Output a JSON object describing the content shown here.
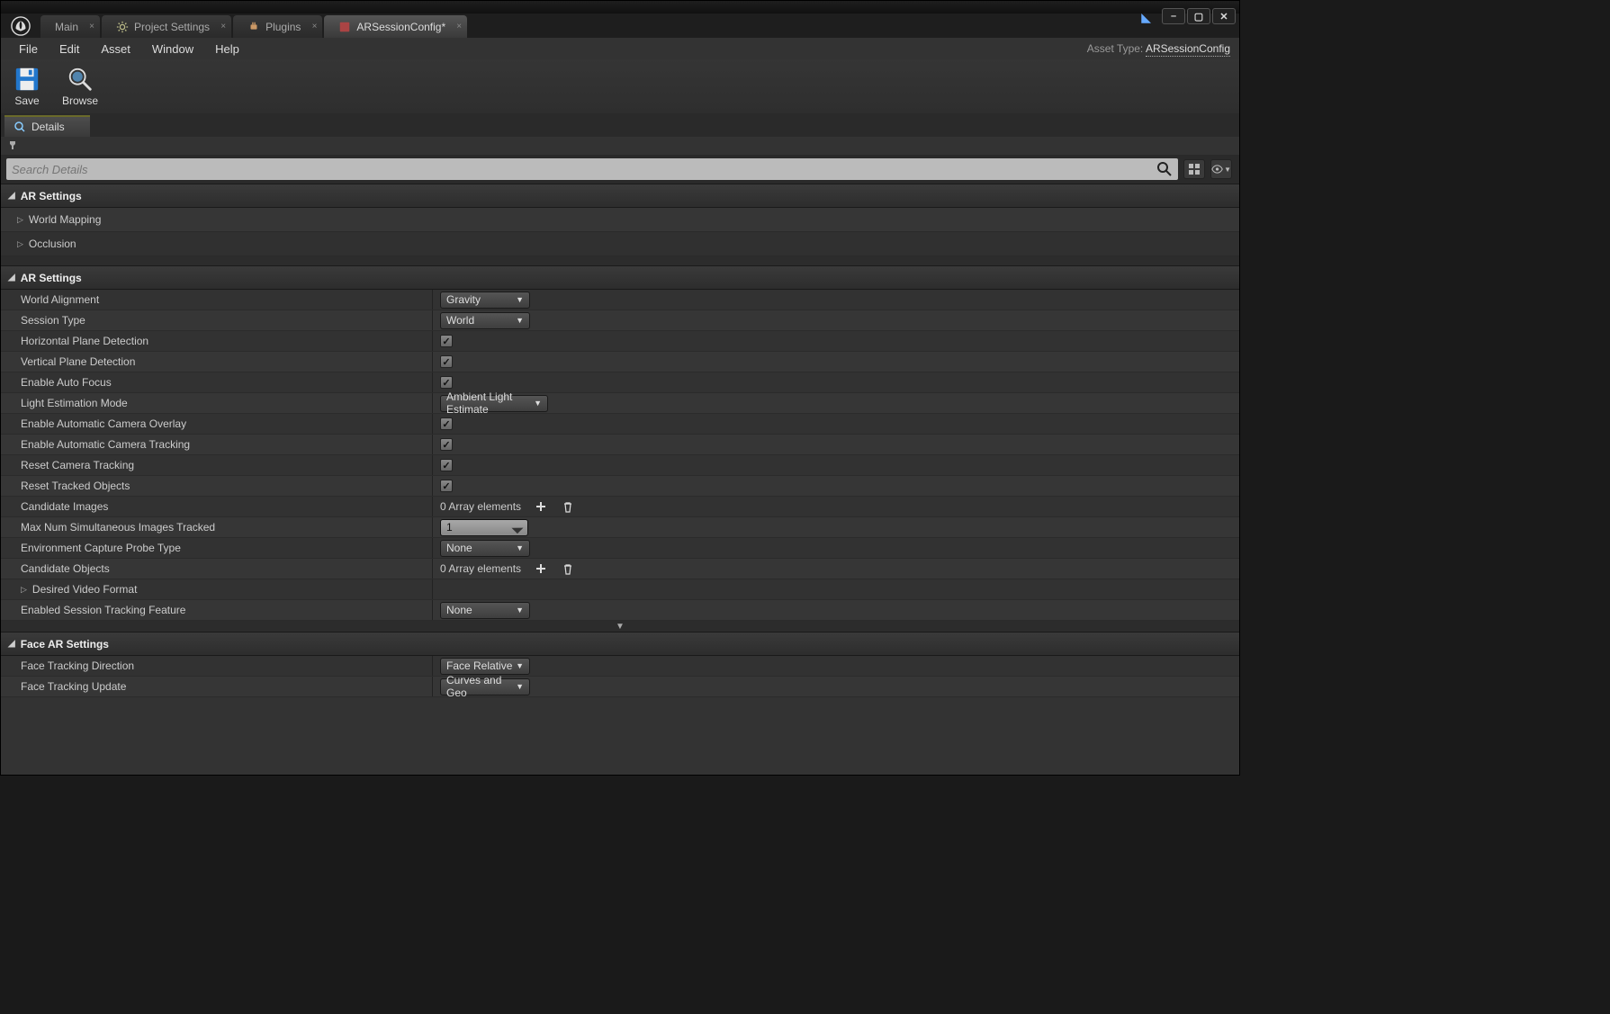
{
  "tabs": {
    "main": "Main",
    "project_settings": "Project Settings",
    "plugins": "Plugins",
    "arsession": "ARSessionConfig*"
  },
  "menu": {
    "file": "File",
    "edit": "Edit",
    "asset": "Asset",
    "window": "Window",
    "help": "Help"
  },
  "asset_type_label": "Asset Type:",
  "asset_type_value": "ARSessionConfig",
  "toolbar": {
    "save": "Save",
    "browse": "Browse"
  },
  "details_tab": "Details",
  "search_placeholder": "Search Details",
  "sections": {
    "ar_settings1": "AR Settings",
    "world_mapping": "World Mapping",
    "occlusion": "Occlusion",
    "ar_settings2": "AR Settings",
    "face_ar_settings": "Face AR Settings"
  },
  "props": {
    "world_alignment": {
      "label": "World Alignment",
      "value": "Gravity"
    },
    "session_type": {
      "label": "Session Type",
      "value": "World"
    },
    "horiz_plane": {
      "label": "Horizontal Plane Detection",
      "checked": true
    },
    "vert_plane": {
      "label": "Vertical Plane Detection",
      "checked": true
    },
    "auto_focus": {
      "label": "Enable Auto Focus",
      "checked": true
    },
    "light_est": {
      "label": "Light Estimation Mode",
      "value": "Ambient Light Estimate"
    },
    "auto_overlay": {
      "label": "Enable Automatic Camera Overlay",
      "checked": true
    },
    "auto_tracking": {
      "label": "Enable Automatic Camera Tracking",
      "checked": true
    },
    "reset_cam": {
      "label": "Reset Camera Tracking",
      "checked": true
    },
    "reset_tracked": {
      "label": "Reset Tracked Objects",
      "checked": true
    },
    "cand_images": {
      "label": "Candidate Images",
      "text": "0 Array elements"
    },
    "max_sim": {
      "label": "Max Num Simultaneous Images Tracked",
      "value": "1"
    },
    "env_probe": {
      "label": "Environment Capture Probe Type",
      "value": "None"
    },
    "cand_objects": {
      "label": "Candidate Objects",
      "text": "0 Array elements"
    },
    "video_fmt": {
      "label": "Desired Video Format"
    },
    "sess_feature": {
      "label": "Enabled Session Tracking Feature",
      "value": "None"
    },
    "face_dir": {
      "label": "Face Tracking Direction",
      "value": "Face Relative"
    },
    "face_update": {
      "label": "Face Tracking Update",
      "value": "Curves and Geo"
    }
  }
}
